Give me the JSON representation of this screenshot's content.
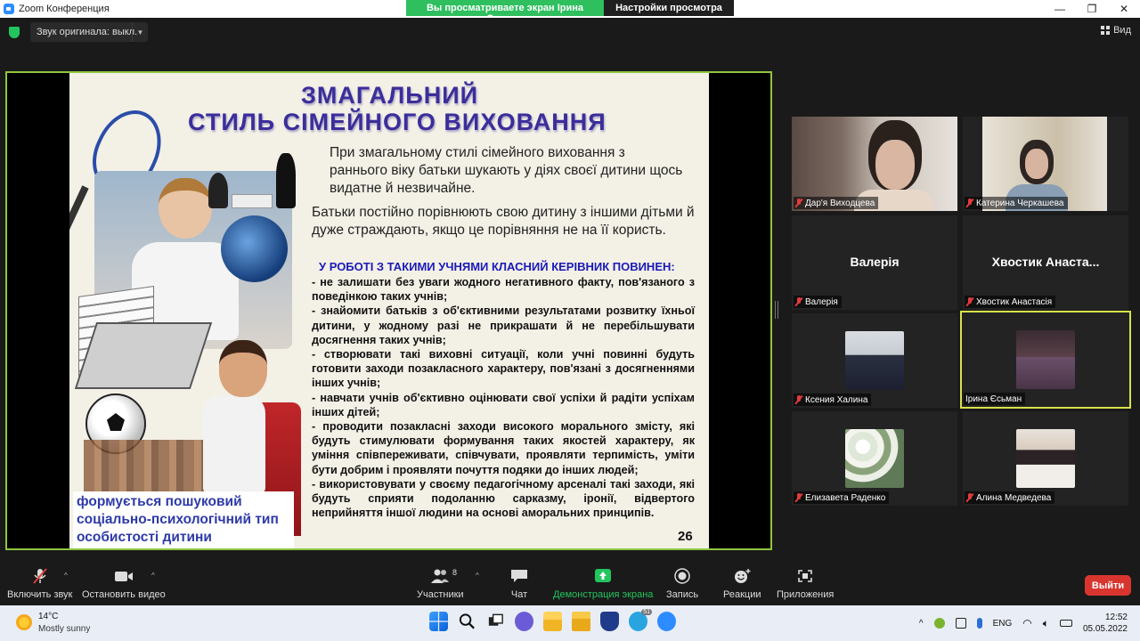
{
  "window": {
    "title": "Zoom Конференция",
    "share_banner": "Вы просматриваете экран Ірина Єсьман",
    "view_settings": "Настройки просмотра ⌄",
    "minimize": "—",
    "maximize": "❐",
    "close": "✕"
  },
  "topbar": {
    "original_sound": "Звук оригинала: выкл.",
    "view_label": "Вид"
  },
  "slide": {
    "title_line1": "ЗМАГАЛЬНИЙ",
    "title_line2": "СТИЛЬ СІМЕЙНОГО ВИХОВАННЯ",
    "para1": "При змагальному стилі сімейного виховання з раннього віку батьки шукають у діях своєї дитини щось видатне й незвичайне.",
    "para2": "Батьки постійно порівнюють свою дитину з іншими дітьми й дуже страждають, якщо це порівняння не на її користь.",
    "subheading": "У РОБОТІ З ТАКИМИ УЧНЯМИ КЛАСНИЙ КЕРІВНИК ПОВИНЕН:",
    "list": [
      "- не залишати без уваги жодного негативного факту, пов'язаного з поведінкою таких учнів;",
      "- знайомити батьків з об'єктивними результатами розвитку їхньої дитини, у жодному разі не прикрашати й не перебільшувати досягнення таких учнів;",
      "- створювати такі виховні ситуації, коли учні повинні будуть готовити заходи позакласного характеру, пов'язані з досягненнями інших учнів;",
      "- навчати учнів об'єктивно оцінювати свої успіхи й радіти успіхам інших дітей;",
      "- проводити позакласні заходи високого морального змісту, які будуть стимулювати формування таких якостей характеру, як уміння співпереживати, співчувати, проявляти терпимість, уміти бути добрим і проявляти почуття подяки до інших людей;",
      "- використовувати у своєму педагогічному арсеналі такі заходи, які будуть сприяти подоланню сарказму, іронії, відвертого неприйняття іншої людини на основі аморальних принципів."
    ],
    "bottom_caption": "формується пошуковий соціально-психологічний тип особистості дитини",
    "page_number": "26"
  },
  "participants": [
    {
      "name": "Дар'я Виходцева",
      "video": true,
      "muted": true
    },
    {
      "name": "Катерина Черкашева",
      "video": true,
      "muted": true
    },
    {
      "name": "Валерія",
      "big_name": "Валерія",
      "video": false,
      "muted": true
    },
    {
      "name": "Хвостик Анастасія",
      "big_name": "Хвостик Анаста...",
      "video": false,
      "muted": true
    },
    {
      "name": "Ксения Халина",
      "video": false,
      "muted": true
    },
    {
      "name": "Ірина Єсьман",
      "video": false,
      "muted": false,
      "active_speaker": true
    },
    {
      "name": "Елизавета Раденко",
      "video": false,
      "muted": true
    },
    {
      "name": "Алина Медведева",
      "video": false,
      "muted": true
    }
  ],
  "toolbar": {
    "unmute": "Включить звук",
    "stop_video": "Остановить видео",
    "participants": "Участники",
    "participants_count": "8",
    "chat": "Чат",
    "share_screen": "Демонстрация экрана",
    "record": "Запись",
    "reactions": "Реакции",
    "apps": "Приложения",
    "leave": "Выйти",
    "caret": "^"
  },
  "taskbar": {
    "weather_temp": "14°C",
    "weather_desc": "Mostly sunny",
    "language": "ENG",
    "time": "12:52",
    "date": "05.05.2022",
    "tray_chevron": "^",
    "badge_count": "51"
  },
  "colors": {
    "share_banner": "#2fbf5f",
    "share_border": "#8ec63f",
    "active_speaker": "#d8e24a",
    "leave_button": "#d9352f",
    "muted_icon": "#e23b3b"
  }
}
